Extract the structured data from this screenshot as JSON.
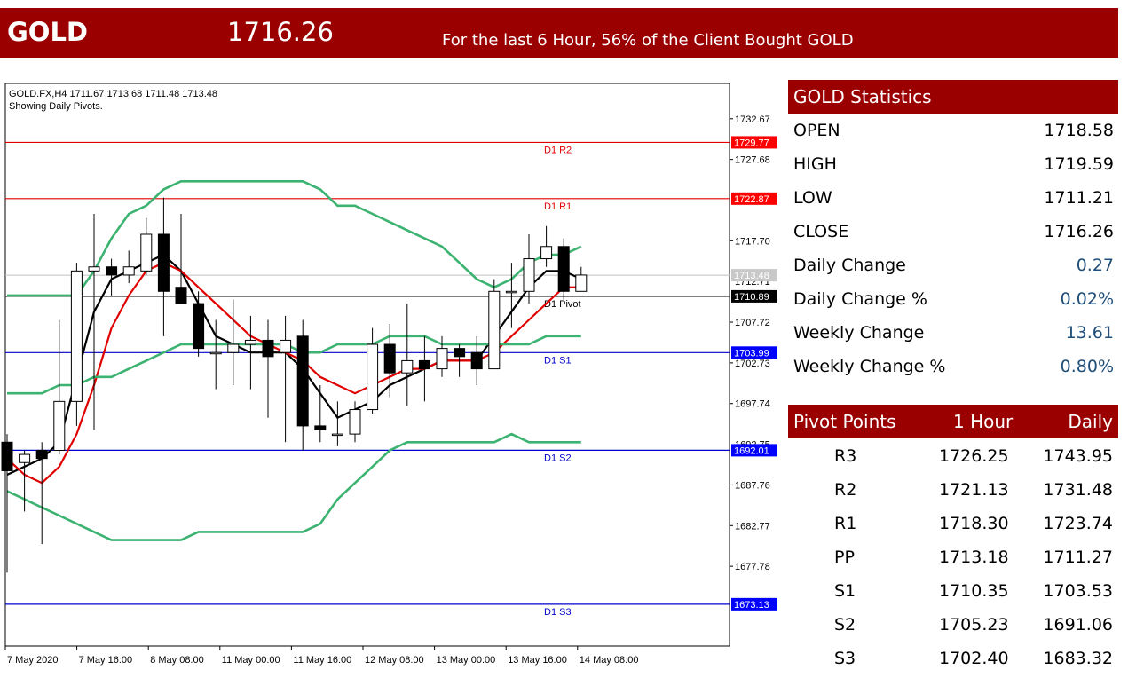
{
  "banner": {
    "symbol": "GOLD",
    "price": "1716.26",
    "message": "For the last 6 Hour, 56% of the Client Bought GOLD"
  },
  "chart": {
    "header_line1": "GOLD.FX,H4  1711.67 1713.68 1711.48 1713.48",
    "header_line2": "Showing Daily Pivots.",
    "y_ticks": [
      "1732.67",
      "1727.68",
      "1717.70",
      "1707.72",
      "1702.73",
      "1697.74",
      "1687.76",
      "1682.77",
      "1677.78"
    ],
    "x_ticks": [
      "7 May 2020",
      "7 May 16:00",
      "8 May 08:00",
      "11 May 00:00",
      "11 May 16:00",
      "12 May 08:00",
      "13 May 00:00",
      "13 May 16:00",
      "14 May 08:00"
    ],
    "pivot_lines": [
      {
        "label": "D1 R2",
        "value": "1729.77",
        "color": "#e00000"
      },
      {
        "label": "D1 R1",
        "value": "1722.87",
        "color": "#e00000"
      },
      {
        "label": "D1 Pivot",
        "value": "1710.89",
        "color": "#000000"
      },
      {
        "label": "D1 S1",
        "value": "1703.99",
        "color": "#0000cc"
      },
      {
        "label": "D1 S2",
        "value": "1692.01",
        "color": "#0000cc"
      },
      {
        "label": "D1 S3",
        "value": "1673.13",
        "color": "#0000cc"
      }
    ],
    "current_price_tag": "1713.48",
    "partial_tags": [
      "1712.71",
      "1692.75"
    ]
  },
  "chart_data": {
    "type": "line",
    "title": "",
    "ylim": [
      1668,
      1737
    ],
    "candles": [
      {
        "o": 1693.0,
        "c": 1689.5,
        "h": 1694.0,
        "l": 1677.0
      },
      {
        "o": 1690.5,
        "c": 1691.5,
        "h": 1692.0,
        "l": 1684.5
      },
      {
        "o": 1692.0,
        "c": 1691.0,
        "h": 1693.0,
        "l": 1680.5
      },
      {
        "o": 1692.0,
        "c": 1698.0,
        "h": 1708.0,
        "l": 1691.5
      },
      {
        "o": 1698.0,
        "c": 1714.0,
        "h": 1715.0,
        "l": 1695.0
      },
      {
        "o": 1714.0,
        "c": 1714.5,
        "h": 1721.0,
        "l": 1694.5
      },
      {
        "o": 1714.5,
        "c": 1713.5,
        "h": 1715.5,
        "l": 1711.0
      },
      {
        "o": 1713.5,
        "c": 1714.5,
        "h": 1716.5,
        "l": 1712.5
      },
      {
        "o": 1714.0,
        "c": 1718.5,
        "h": 1720.5,
        "l": 1713.5
      },
      {
        "o": 1718.5,
        "c": 1711.5,
        "h": 1723.0,
        "l": 1706.0
      },
      {
        "o": 1712.0,
        "c": 1710.0,
        "h": 1721.0,
        "l": 1710.0
      },
      {
        "o": 1710.0,
        "c": 1704.5,
        "h": 1711.5,
        "l": 1703.5
      },
      {
        "o": 1704.0,
        "c": 1704.0,
        "h": 1708.0,
        "l": 1699.5
      },
      {
        "o": 1704.0,
        "c": 1705.0,
        "h": 1710.5,
        "l": 1700.0
      },
      {
        "o": 1705.0,
        "c": 1705.5,
        "h": 1708.5,
        "l": 1699.5
      },
      {
        "o": 1705.5,
        "c": 1703.5,
        "h": 1708.0,
        "l": 1696.0
      },
      {
        "o": 1704.0,
        "c": 1705.5,
        "h": 1708.5,
        "l": 1693.0
      },
      {
        "o": 1706.0,
        "c": 1695.0,
        "h": 1708.0,
        "l": 1692.0
      },
      {
        "o": 1695.0,
        "c": 1694.5,
        "h": 1700.0,
        "l": 1693.0
      },
      {
        "o": 1694.0,
        "c": 1694.0,
        "h": 1698.0,
        "l": 1692.5
      },
      {
        "o": 1694.0,
        "c": 1697.0,
        "h": 1698.0,
        "l": 1693.0
      },
      {
        "o": 1697.0,
        "c": 1705.0,
        "h": 1707.0,
        "l": 1696.5
      },
      {
        "o": 1705.0,
        "c": 1701.5,
        "h": 1707.5,
        "l": 1698.5
      },
      {
        "o": 1701.5,
        "c": 1703.0,
        "h": 1710.0,
        "l": 1697.5
      },
      {
        "o": 1703.0,
        "c": 1702.0,
        "h": 1706.0,
        "l": 1698.0
      },
      {
        "o": 1702.0,
        "c": 1704.5,
        "h": 1706.0,
        "l": 1701.0
      },
      {
        "o": 1704.5,
        "c": 1703.5,
        "h": 1705.0,
        "l": 1701.0
      },
      {
        "o": 1704.0,
        "c": 1702.0,
        "h": 1706.0,
        "l": 1700.0
      },
      {
        "o": 1702.0,
        "c": 1711.5,
        "h": 1713.0,
        "l": 1702.0
      },
      {
        "o": 1711.5,
        "c": 1711.5,
        "h": 1715.0,
        "l": 1707.0
      },
      {
        "o": 1711.5,
        "c": 1715.5,
        "h": 1718.5,
        "l": 1710.0
      },
      {
        "o": 1715.5,
        "c": 1717.0,
        "h": 1719.5,
        "l": 1714.5
      },
      {
        "o": 1717.0,
        "c": 1711.5,
        "h": 1718.0,
        "l": 1710.5
      },
      {
        "o": 1711.5,
        "c": 1713.5,
        "h": 1714.5,
        "l": 1711.5
      }
    ],
    "series": [
      {
        "color": "#000000",
        "values": [
          1689,
          1690,
          1691,
          1693,
          1701,
          1709,
          1713,
          1714,
          1715,
          1716,
          1714,
          1710,
          1706,
          1705,
          1704,
          1704,
          1704,
          1702,
          1699,
          1696,
          1697,
          1698,
          1700,
          1701,
          1702,
          1703,
          1703,
          1703,
          1706,
          1709,
          1712,
          1714,
          1714,
          1713
        ]
      },
      {
        "color": "#e00000",
        "values": [
          1691,
          1689,
          1688,
          1690,
          1694,
          1700,
          1707,
          1711,
          1714,
          1715,
          1714,
          1712,
          1710,
          1708,
          1706,
          1705,
          1704,
          1703,
          1701,
          1700,
          1699,
          1700,
          1701,
          1702,
          1702,
          1703,
          1703,
          1703,
          1704,
          1706,
          1708,
          1710,
          1712,
          1712
        ]
      },
      {
        "color": "#3cb371",
        "values": [
          1711,
          1711,
          1711,
          1711,
          1711,
          1714,
          1718,
          1721,
          1722,
          1724,
          1725,
          1725,
          1725,
          1725,
          1725,
          1725,
          1725,
          1725,
          1724,
          1722,
          1722,
          1721,
          1720,
          1719,
          1718,
          1717,
          1715,
          1713,
          1712,
          1713,
          1715,
          1716,
          1716,
          1717
        ]
      },
      {
        "color": "#3cb371",
        "values": [
          1699,
          1699,
          1699,
          1700,
          1700,
          1701,
          1701,
          1702,
          1703,
          1704,
          1705,
          1705,
          1705,
          1705,
          1705,
          1705,
          1705,
          1704,
          1704,
          1705,
          1705,
          1705,
          1706,
          1706,
          1706,
          1705,
          1705,
          1705,
          1705,
          1705,
          1705,
          1706,
          1706,
          1706
        ]
      },
      {
        "color": "#3cb371",
        "values": [
          1687,
          1686,
          1685,
          1684,
          1683,
          1682,
          1681,
          1681,
          1681,
          1681,
          1681,
          1682,
          1682,
          1682,
          1682,
          1682,
          1682,
          1682,
          1683,
          1686,
          1688,
          1690,
          1692,
          1693,
          1693,
          1693,
          1693,
          1693,
          1693,
          1694,
          1693,
          1693,
          1693,
          1693
        ]
      }
    ]
  },
  "stats": {
    "title": "GOLD Statistics",
    "rows": [
      {
        "label": "OPEN",
        "value": "1718.58"
      },
      {
        "label": "HIGH",
        "value": "1719.59"
      },
      {
        "label": "LOW",
        "value": "1711.21"
      },
      {
        "label": "CLOSE",
        "value": "1716.26"
      },
      {
        "label": "Daily Change",
        "value": "0.27"
      },
      {
        "label": "Daily Change %",
        "value": "0.02%"
      },
      {
        "label": "Weekly Change",
        "value": "13.61"
      },
      {
        "label": "Weekly Change %",
        "value": "0.80%"
      }
    ]
  },
  "pivots": {
    "headers": [
      "Pivot Points",
      "1 Hour",
      "Daily"
    ],
    "rows": [
      [
        "R3",
        "1726.25",
        "1743.95"
      ],
      [
        "R2",
        "1721.13",
        "1731.48"
      ],
      [
        "R1",
        "1718.30",
        "1723.74"
      ],
      [
        "PP",
        "1713.18",
        "1711.27"
      ],
      [
        "S1",
        "1710.35",
        "1703.53"
      ],
      [
        "S2",
        "1705.23",
        "1691.06"
      ],
      [
        "S3",
        "1702.40",
        "1683.32"
      ]
    ]
  }
}
